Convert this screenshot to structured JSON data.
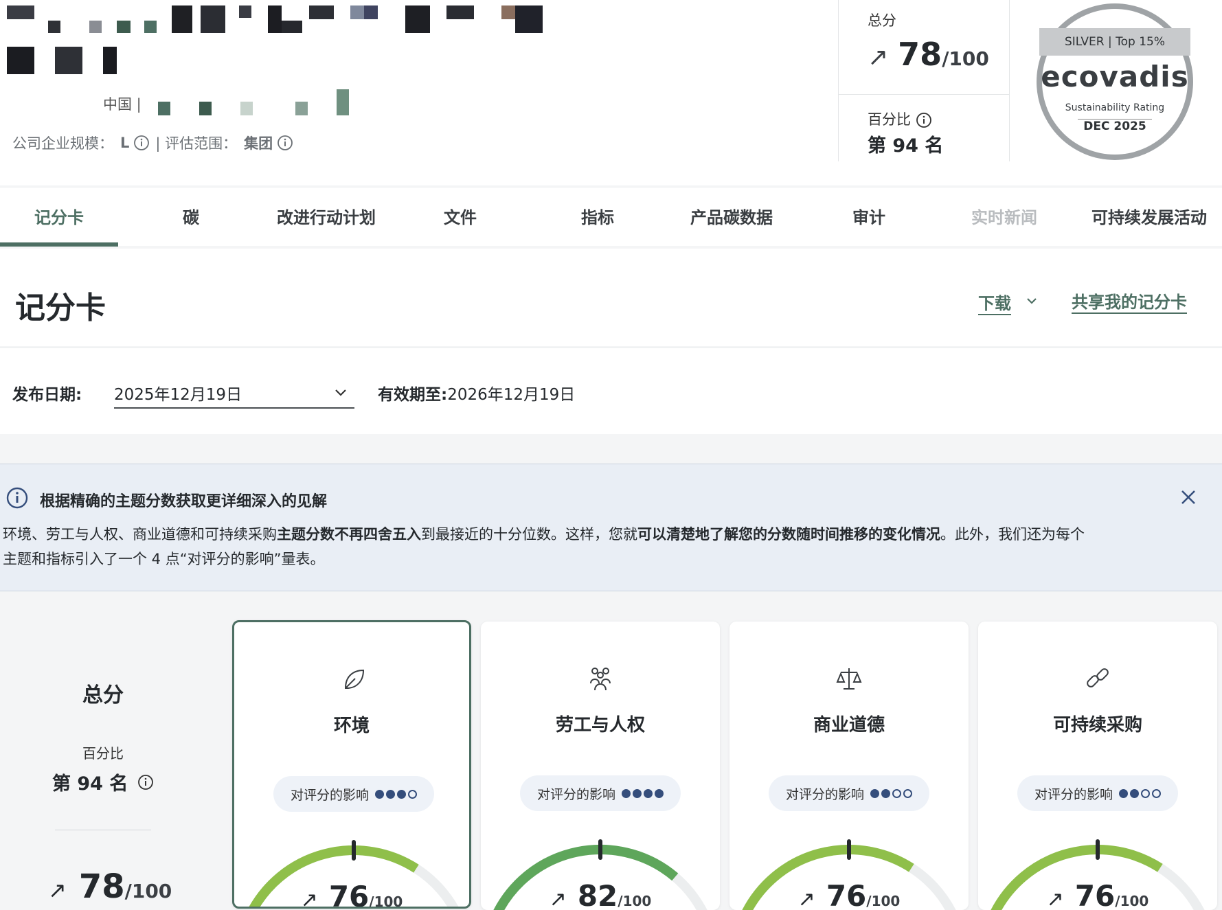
{
  "header": {
    "country_label": "中国 |",
    "size_label": "公司企业规模：",
    "size_value": "L",
    "scope_label": "| 评估范围：",
    "scope_value": "集团",
    "score_label": "总分",
    "score_value": "78",
    "score_max": "/100",
    "percentile_label": "百分比",
    "percentile_rank": "第 94 名"
  },
  "badge": {
    "tier": "SILVER | Top 15%",
    "brand": "ecovadis",
    "subtitle": "Sustainability Rating",
    "date": "DEC 2025"
  },
  "tabs": [
    {
      "label": "记分卡"
    },
    {
      "label": "碳"
    },
    {
      "label": "改进行动计划"
    },
    {
      "label": "文件"
    },
    {
      "label": "指标"
    },
    {
      "label": "产品碳数据"
    },
    {
      "label": "审计"
    },
    {
      "label": "实时新闻"
    },
    {
      "label": "可持续发展活动"
    }
  ],
  "page": {
    "title": "记分卡",
    "download_label": "下载",
    "share_label": "共享我的记分卡"
  },
  "dates": {
    "published_label": "发布日期:",
    "published_value": "2025年12月19日",
    "valid_label": "有效期至:",
    "valid_value": "2026年12月19日"
  },
  "banner": {
    "title": "根据精确的主题分数获取更详细深入的见解",
    "body_1": "环境、劳工与人权、商业道德和可持续采购",
    "body_2": "主题分数不再四舍五入",
    "body_3": "到最接近的十分位数。这样，您就",
    "body_4": "可以清楚地了解您的分数随时间推移的变化情况",
    "body_5": "。此外，我们还为每个主题和指标引入了一个 4 点“对评分的影响”量表。"
  },
  "overall": {
    "title": "总分",
    "percentile_label": "百分比",
    "rank": "第 94 名",
    "score": "78",
    "max": "/100"
  },
  "themes": [
    {
      "name": "环境",
      "impact_label": "对评分的影响",
      "impact_level": 3,
      "score": "76",
      "max": "/100",
      "icon": "leaf-icon",
      "color": "#8fbf4a"
    },
    {
      "name": "劳工与人权",
      "impact_label": "对评分的影响",
      "impact_level": 4,
      "score": "82",
      "max": "/100",
      "icon": "people-icon",
      "color": "#5ea65b"
    },
    {
      "name": "商业道德",
      "impact_label": "对评分的影响",
      "impact_level": 2,
      "score": "76",
      "max": "/100",
      "icon": "scales-icon",
      "color": "#8fbf4a"
    },
    {
      "name": "可持续采购",
      "impact_label": "对评分的影响",
      "impact_level": 2,
      "score": "76",
      "max": "/100",
      "icon": "link-icon",
      "color": "#8fbf4a"
    }
  ],
  "colors": {
    "accent": "#4d6f63",
    "impact": "#354e7c",
    "banner_bg": "#e9eef5"
  }
}
